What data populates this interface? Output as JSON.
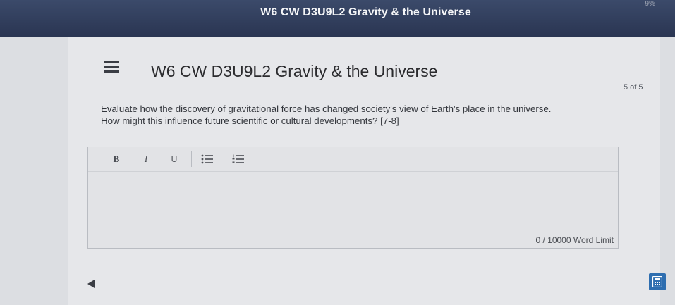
{
  "topbar": {
    "title": "W6 CW D3U9L2 Gravity & the Universe",
    "status": "9%"
  },
  "header": {
    "menu_icon": "hamburger-menu-icon",
    "title": "W6 CW D3U9L2 Gravity & the Universe",
    "page_count": "5 of 5"
  },
  "question": {
    "line1": "Evaluate how the discovery of gravitational force has changed society's view of Earth's place in the universe.",
    "line2": "How might this influence future scientific or cultural developments? [7-8]"
  },
  "editor": {
    "toolbar": {
      "bold": "B",
      "italic": "I",
      "underline": "U",
      "bullet_icon": "bulleted-list-icon",
      "numbered_icon": "numbered-list-icon"
    },
    "value": "",
    "word_limit": "0 / 10000 Word Limit"
  },
  "footer": {
    "prev_icon": "left-arrow-icon",
    "side_icon": "calculator-icon"
  },
  "colors": {
    "topbar": "#2f3a57",
    "accent": "#2e6eb0"
  }
}
